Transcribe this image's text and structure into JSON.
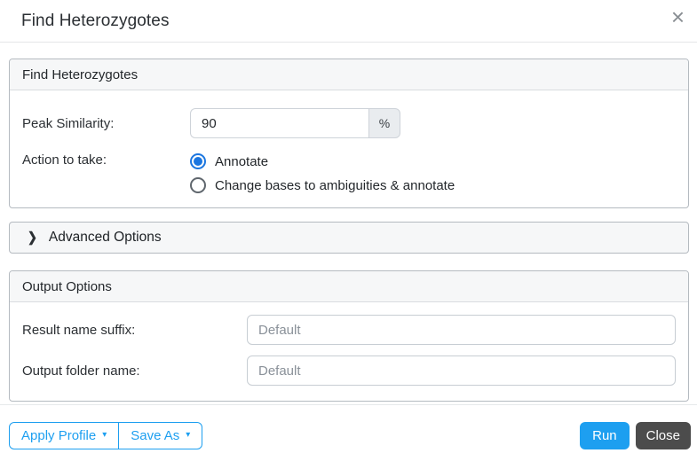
{
  "dialog": {
    "title": "Find Heterozygotes"
  },
  "icons": {
    "close": "×",
    "chevron_right": "❯",
    "caret_down": "▾"
  },
  "sections": {
    "parameters": {
      "header": "Find Heterozygotes",
      "peak_similarity": {
        "label": "Peak Similarity:",
        "value": "90",
        "unit": "%"
      },
      "action_to_take": {
        "label": "Action to take:",
        "options": [
          {
            "label": "Annotate",
            "selected": true
          },
          {
            "label": "Change bases to ambiguities & annotate",
            "selected": false
          }
        ]
      }
    },
    "advanced": {
      "header": "Advanced Options",
      "collapsed": true
    },
    "output": {
      "header": "Output Options",
      "result_name_suffix": {
        "label": "Result name suffix:",
        "value": "",
        "placeholder": "Default"
      },
      "output_folder_name": {
        "label": "Output folder name:",
        "value": "",
        "placeholder": "Default"
      }
    }
  },
  "footer": {
    "apply_profile_label": "Apply Profile",
    "save_as_label": "Save As",
    "run_label": "Run",
    "close_label": "Close"
  },
  "colors": {
    "accent_blue": "#1d9ff0",
    "radio_blue": "#1b76e0",
    "close_button_bg": "#4c4c4c",
    "panel_header_bg": "#f6f7f8",
    "panel_border": "#b4bac0"
  }
}
